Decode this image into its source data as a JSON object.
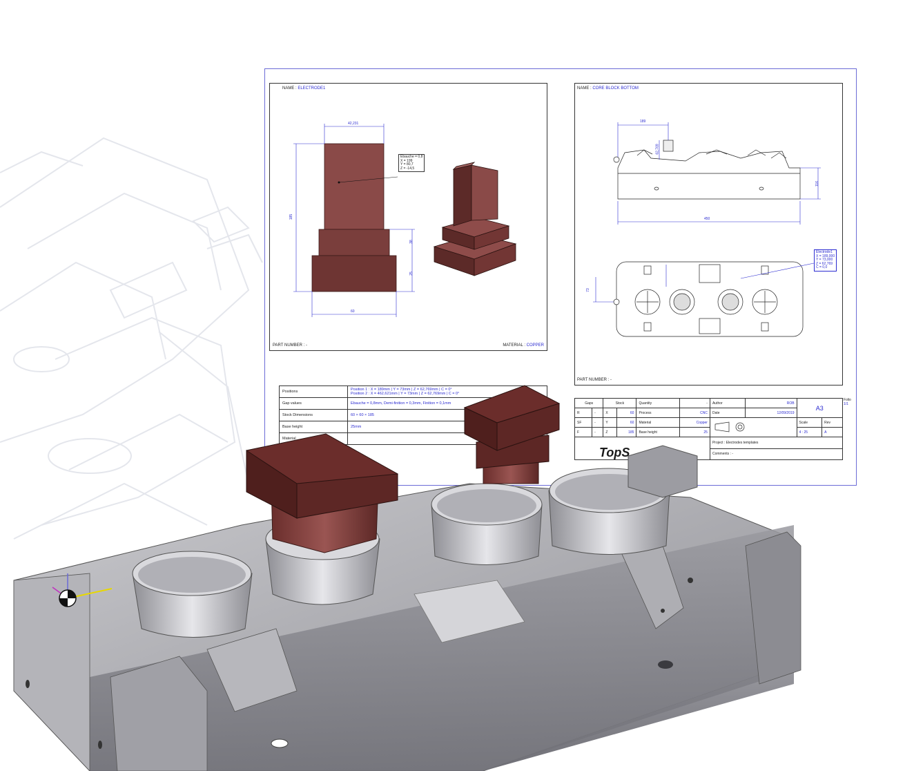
{
  "drawing_sheet": {
    "left_view": {
      "name_label": "NAME :",
      "name_value": "ELECTRODE1",
      "part_number": "PART NUMBER : -",
      "material_label": "MATERIAL :",
      "material_value": "COPPER",
      "dim_top": "42,231",
      "dim_height": "185",
      "dim_bottom": "60",
      "dim_step1": "38",
      "dim_step2": "25",
      "note": [
        "Ebauche = 0,8",
        "X = 199",
        "Y = 80,7",
        "Z = -14,5"
      ]
    },
    "right_view": {
      "name_label": "NAME :",
      "name_value": "CORE BLOCK BOTTOM",
      "part_number": "PART NUMBER : -",
      "dim_top": "189",
      "dim_height": "116",
      "dim_width": "450",
      "dim_small": "62,769",
      "dim_side": "73",
      "note": [
        "Electrode1",
        "X = 189,000",
        "Y = 73,000",
        "Z = 62,769",
        "C = 0,0"
      ]
    },
    "info_table": [
      {
        "label": "Positions",
        "value": "Position 1 : X = 189mm | Y = 73mm | Z = 62,769mm | C = 0°\nPosition 2 : X = 462,621mm | Y = 73mm | Z = 62,769mm | C = 0°"
      },
      {
        "label": "Gap values",
        "value": "Ebauche = 0,8mm, Demi-finition = 0,3mm, Finition = 0,1mm"
      },
      {
        "label": "Stock Dimensions",
        "value": "60 × 60 × 185"
      },
      {
        "label": "Base height",
        "value": "25mm"
      },
      {
        "label": "Material",
        "value": ""
      }
    ],
    "title_block": {
      "h_gaps": "Gaps",
      "h_stock": "Stock",
      "h_quantity": "Quantity",
      "quantity_value": "-",
      "rows": [
        {
          "g": "R",
          "gv": "-",
          "s": "X",
          "sv": "60",
          "k": "Process",
          "kv": "CNC"
        },
        {
          "g": "SF",
          "gv": "-",
          "s": "Y",
          "sv": "60",
          "k": "Material",
          "kv": "Copper"
        },
        {
          "g": "F",
          "gv": "-",
          "s": "Z",
          "sv": "185",
          "k": "Base height",
          "kv": "25"
        }
      ],
      "author_label": "Author",
      "author_value": "ROB",
      "date_label": "Date",
      "date_value": "12/09/2019",
      "format": "A3",
      "scale_label": "Scale",
      "scale_value": "4 : 25",
      "rev_label": "Rev",
      "rev_value": "A",
      "folio_label": "Folio",
      "folio_value": "1/1",
      "project_label": "Project :",
      "project_value": "Electrodes templates",
      "comments_label": "Comments :",
      "comments_value": "-",
      "brand_fragment": "TopS"
    }
  },
  "colors": {
    "sheet_border": "#6b6bd6",
    "annotation_blue": "#2a2ad0",
    "electrode_face": "#8a4a48",
    "electrode_dark": "#5c2a28",
    "mold_gray": "#a9a9ad"
  }
}
